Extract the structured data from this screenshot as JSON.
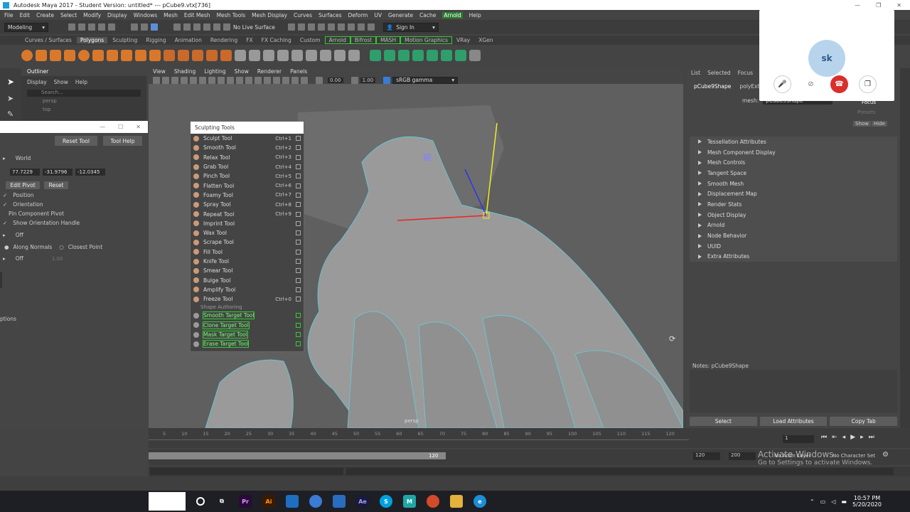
{
  "window": {
    "title": "Autodesk Maya 2017 - Student Version: untitled*   ---   pCube9.vtx[736]"
  },
  "menubar": [
    "File",
    "Edit",
    "Create",
    "Select",
    "Modify",
    "Display",
    "Windows",
    "Mesh",
    "Edit Mesh",
    "Mesh Tools",
    "Mesh Display",
    "Curves",
    "Surfaces",
    "Deform",
    "UV",
    "Generate",
    "Cache",
    "Arnold",
    "Help"
  ],
  "statusline": {
    "mode": "Modeling",
    "live_surface": "No Live Surface",
    "sign_in": "Sign In"
  },
  "shelf_tabs": [
    "Curves / Surfaces",
    "Polygons",
    "Sculpting",
    "Rigging",
    "Animation",
    "Rendering",
    "FX",
    "FX Caching",
    "Custom",
    "Arnold",
    "Bifrost",
    "MASH",
    "Motion Graphics",
    "VRay",
    "XGen"
  ],
  "shelf_active": "Polygons",
  "outliner": {
    "title": "Outliner",
    "menus": [
      "Display",
      "Show",
      "Help"
    ],
    "search_placeholder": "Search...",
    "items": [
      "persp",
      "top"
    ]
  },
  "tool_options": {
    "reset_tool": "Reset Tool",
    "tool_help": "Tool Help",
    "space": "World",
    "pivot": [
      "77.7229",
      "-31.9796",
      "-12.0345"
    ],
    "edit_pivot": "Edit Pivot",
    "reset": "Reset",
    "position": "Position",
    "orientation": "Orientation",
    "pin_component_pivot": "Pin Component Pivot",
    "show_orientation_handle": "Show Orientation Handle",
    "off1": "Off",
    "along_normals": "Along Normals",
    "closest_point": "Closest Point",
    "off2": "Off",
    "off2_value": "1.00",
    "options": "ptions"
  },
  "viewport": {
    "menus": [
      "View",
      "Shading",
      "Lighting",
      "Show",
      "Renderer",
      "Panels"
    ],
    "value_a": "0.00",
    "value_b": "1.00",
    "colorspace": "sRGB gamma",
    "camera_label": "persp"
  },
  "sculpting_tools": {
    "title": "Sculpting Tools",
    "tools": [
      {
        "label": "Sculpt Tool",
        "shortcut": "Ctrl+1"
      },
      {
        "label": "Smooth Tool",
        "shortcut": "Ctrl+2"
      },
      {
        "label": "Relax Tool",
        "shortcut": "Ctrl+3"
      },
      {
        "label": "Grab Tool",
        "shortcut": "Ctrl+4"
      },
      {
        "label": "Pinch Tool",
        "shortcut": "Ctrl+5"
      },
      {
        "label": "Flatten Tool",
        "shortcut": "Ctrl+6"
      },
      {
        "label": "Foamy Tool",
        "shortcut": "Ctrl+7"
      },
      {
        "label": "Spray Tool",
        "shortcut": "Ctrl+8"
      },
      {
        "label": "Repeat Tool",
        "shortcut": "Ctrl+9"
      },
      {
        "label": "Imprint Tool",
        "shortcut": ""
      },
      {
        "label": "Wax Tool",
        "shortcut": ""
      },
      {
        "label": "Scrape Tool",
        "shortcut": ""
      },
      {
        "label": "Fill Tool",
        "shortcut": ""
      },
      {
        "label": "Knife Tool",
        "shortcut": ""
      },
      {
        "label": "Smear Tool",
        "shortcut": ""
      },
      {
        "label": "Bulge Tool",
        "shortcut": ""
      },
      {
        "label": "Amplify Tool",
        "shortcut": ""
      },
      {
        "label": "Freeze Tool",
        "shortcut": "Ctrl+0"
      }
    ],
    "section": "Shape Authoring",
    "authoring": [
      "Smooth Target Tool",
      "Clone Target Tool",
      "Mask Target Tool",
      "Erase Target Tool"
    ]
  },
  "attribute_editor": {
    "menus": [
      "List",
      "Selected",
      "Focus",
      "Att"
    ],
    "tabs": [
      "pCube9Shape",
      "polyExt"
    ],
    "focus": "Focus",
    "presets": "Presets",
    "show": "Show",
    "hide": "Hide",
    "mesh_label": "mesh:",
    "mesh_value": "pCube9Shape",
    "sections": [
      "Tessellation Attributes",
      "Mesh Component Display",
      "Mesh Controls",
      "Tangent Space",
      "Smooth Mesh",
      "Displacement Map",
      "Render Stats",
      "Object Display",
      "Arnold",
      "Node Behavior",
      "UUID",
      "Extra Attributes"
    ],
    "notes": "Notes:  pCube9Shape",
    "buttons": [
      "Select",
      "Load Attributes",
      "Copy Tab"
    ]
  },
  "timeline": {
    "ticks": [
      "5",
      "10",
      "15",
      "20",
      "25",
      "30",
      "35",
      "40",
      "45",
      "50",
      "55",
      "60",
      "65",
      "70",
      "75",
      "80",
      "85",
      "90",
      "95",
      "100",
      "105",
      "110",
      "115",
      "120"
    ],
    "current_frame": "1",
    "range_end_label": "120",
    "start": "120",
    "end": "200",
    "anim_layer": "No Anim Layer",
    "char_set": "No Character Set"
  },
  "watermark": {
    "line1": "Activate Windows",
    "line2": "Go to Settings to activate Windows."
  },
  "call": {
    "avatar": "sk"
  },
  "taskbar": {
    "time": "10:57 PM",
    "date": "5/20/2020",
    "apps": [
      "Pr",
      "Ai",
      "Ae",
      "S",
      "M"
    ]
  }
}
